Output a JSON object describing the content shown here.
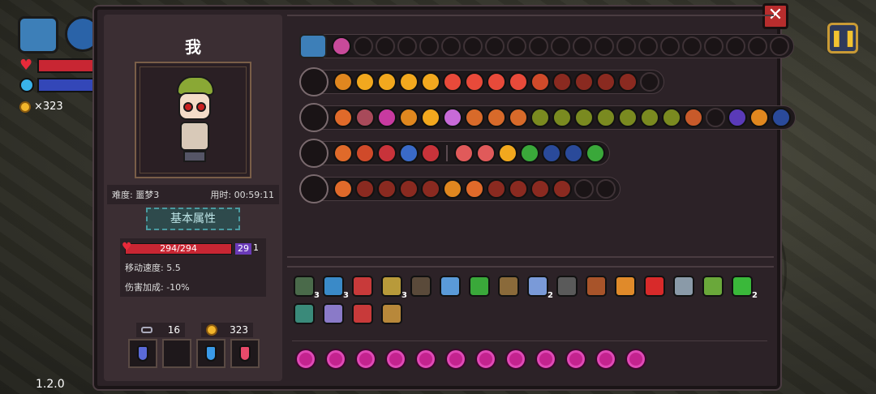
{
  "hud": {
    "coins": "×323",
    "version": "1.2.0"
  },
  "character": {
    "name": "我",
    "difficulty": "难度: 噩梦3",
    "time": "用时: 00:59:11",
    "attr_title": "基本属性",
    "hp": "294/294",
    "shield": "29",
    "shield_extra": "1",
    "move_speed": "移动速度: 5.5",
    "damage_bonus": "伤害加成: -10%",
    "keys": "16",
    "gold": "323"
  },
  "weapon_rows": [
    {
      "name": "chest-row",
      "dots": [
        "#c84a9a"
      ],
      "empty": 20
    },
    {
      "name": "staff-1",
      "dots": [
        "#e0871f",
        "#f2a81e",
        "#f2a81e",
        "#f2a81e",
        "#f2a81e",
        "#e84a3a",
        "#e84a3a",
        "#e84a3a",
        "#e84a3a",
        "#d04a2a",
        "#8a2a20",
        "#8a2a20",
        "#8a2a20",
        "#8a2a20"
      ],
      "empty": 1
    },
    {
      "name": "staff-2",
      "dots": [
        "#e06a2a",
        "#a84a5a",
        "#c83aa0",
        "#e0871f",
        "#f2a81e",
        "#c86ad8",
        "#d86a2a",
        "#d86a2a",
        "#d86a2a",
        "#7a8a20",
        "#7a8a20",
        "#7a8a20",
        "#7a8a20",
        "#7a8a20",
        "#7a8a20",
        "#7a8a20",
        "#c85a2a"
      ],
      "empty": 1,
      "tail": [
        "#5a3ab8",
        "#e0871f",
        "#2a4a9a"
      ]
    },
    {
      "name": "staff-3",
      "dots": [
        "#e06a2a",
        "#d04a2a",
        "#c8333a",
        "#3a6ac8",
        "#c8333a"
      ],
      "sep": true,
      "tail": [
        "#e05a5a",
        "#e05a5a",
        "#f2a81e",
        "#3aa83a",
        "#2a4a9a",
        "#2a4a9a",
        "#3aa83a"
      ]
    },
    {
      "name": "staff-4",
      "dots": [
        "#e06a2a",
        "#8a2a20",
        "#8a2a20",
        "#8a2a20",
        "#8a2a20",
        "#e0871f",
        "#e06a2a",
        "#8a2a20",
        "#8a2a20",
        "#8a2a20",
        "#8a2a20"
      ],
      "empty": 2
    }
  ],
  "items": [
    {
      "color": "#4a6a4a",
      "count": "3"
    },
    {
      "color": "#3a8ac8",
      "count": "3"
    },
    {
      "color": "#c83a3a",
      "count": ""
    },
    {
      "color": "#b89a3a",
      "count": "3"
    },
    {
      "color": "#5a4a3a",
      "count": ""
    },
    {
      "color": "#5a9ad8",
      "count": ""
    },
    {
      "color": "#3aa83a",
      "count": ""
    },
    {
      "color": "#8a6a3a",
      "count": ""
    },
    {
      "color": "#7a9ad8",
      "count": "2"
    },
    {
      "color": "#5a5a5a",
      "count": ""
    },
    {
      "color": "#a8542a",
      "count": ""
    },
    {
      "color": "#e08a2a",
      "count": ""
    },
    {
      "color": "#d82a2a",
      "count": ""
    },
    {
      "color": "#8a9aa8",
      "count": ""
    },
    {
      "color": "#6aa83a",
      "count": ""
    },
    {
      "color": "#3ab83a",
      "count": "2"
    },
    {
      "color": "#3a8a7a",
      "count": ""
    },
    {
      "color": "#8a7ac8",
      "count": ""
    },
    {
      "color": "#c83a3a",
      "count": ""
    },
    {
      "color": "#b8883a",
      "count": ""
    }
  ],
  "buffs": 12
}
